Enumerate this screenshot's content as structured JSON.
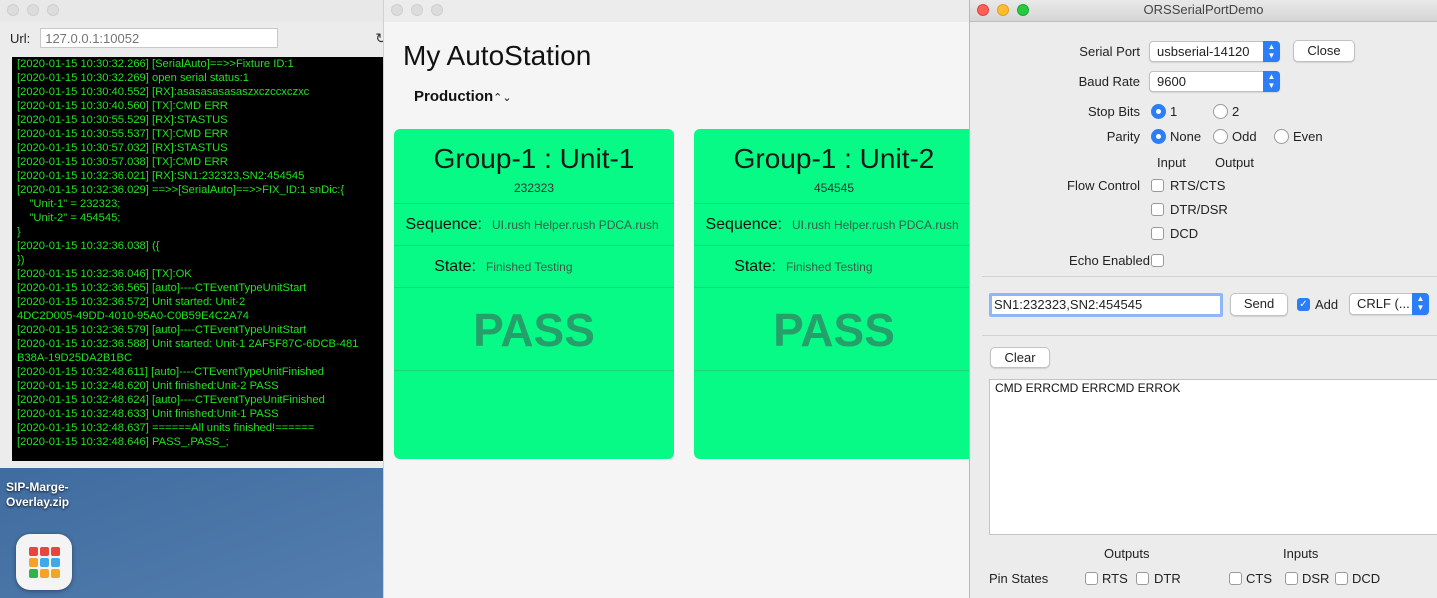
{
  "desktop": {
    "file_icon_label": "SIP-Marge-Overlay.zip",
    "launchpad_colors": [
      "#e8453c",
      "#e8453c",
      "#e8453c",
      "#f3a32a",
      "#3fa9e6",
      "#3fa9e6",
      "#34b24a",
      "#f3a32a",
      "#f3a32a"
    ]
  },
  "log_window": {
    "url_label": "Url:",
    "url_placeholder": "127.0.0.1:10052",
    "log_text": "[2020-01-15 10:30:32.266] [SerialAuto]==>>Fixture ID:1\n[2020-01-15 10:30:32.269] open serial status:1\n[2020-01-15 10:30:40.552] [RX]:asasasasasaszxczccxczxc\n[2020-01-15 10:30:40.560] [TX]:CMD ERR\n[2020-01-15 10:30:55.529] [RX]:STASTUS\n[2020-01-15 10:30:55.537] [TX]:CMD ERR\n[2020-01-15 10:30:57.032] [RX]:STASTUS\n[2020-01-15 10:30:57.038] [TX]:CMD ERR\n[2020-01-15 10:32:36.021] [RX]:SN1:232323,SN2:454545\n[2020-01-15 10:32:36.029] ==>>[SerialAuto]==>>FIX_ID:1 snDic:{\n    \"Unit-1\" = 232323;\n    \"Unit-2\" = 454545;\n}\n[2020-01-15 10:32:36.038] ({\n})\n[2020-01-15 10:32:36.046] [TX]:OK\n[2020-01-15 10:32:36.565] [auto]----CTEventTypeUnitStart\n[2020-01-15 10:32:36.572] Unit started: Unit-2\n4DC2D005-49DD-4010-95A0-C0B59E4C2A74\n[2020-01-15 10:32:36.579] [auto]----CTEventTypeUnitStart\n[2020-01-15 10:32:36.588] Unit started: Unit-1 2AF5F87C-6DCB-481\nB38A-19D25DA2B1BC\n[2020-01-15 10:32:48.611] [auto]----CTEventTypeUnitFinished\n[2020-01-15 10:32:48.620] Unit finished:Unit-2 PASS\n[2020-01-15 10:32:48.624] [auto]----CTEventTypeUnitFinished\n[2020-01-15 10:32:48.633] Unit finished:Unit-1 PASS\n[2020-01-15 10:32:48.637] ======All units finished!======\n[2020-01-15 10:32:48.646] PASS_,PASS_;"
  },
  "autostation": {
    "title": "My AutoStation",
    "mode": "Production",
    "units": [
      {
        "title": "Group-1 : Unit-1",
        "sn": "232323",
        "sequence_label": "Sequence:",
        "sequence": "UI.rush Helper.rush PDCA.rush",
        "state_label": "State:",
        "state": "Finished Testing",
        "result": "PASS"
      },
      {
        "title": "Group-1 : Unit-2",
        "sn": "454545",
        "sequence_label": "Sequence:",
        "sequence": "UI.rush Helper.rush PDCA.rush",
        "state_label": "State:",
        "state": "Finished Testing",
        "result": "PASS"
      }
    ],
    "card_color": "#07fa86"
  },
  "serial": {
    "window_title": "ORSSerialPortDemo",
    "serial_port_label": "Serial Port",
    "serial_port_value": "usbserial-14120",
    "close_button": "Close",
    "baud_rate_label": "Baud Rate",
    "baud_rate_value": "9600",
    "stop_bits_label": "Stop Bits",
    "stop_bits_1": "1",
    "stop_bits_2": "2",
    "parity_label": "Parity",
    "parity_none": "None",
    "parity_odd": "Odd",
    "parity_even": "Even",
    "input_header": "Input",
    "output_header": "Output",
    "flow_control_label": "Flow Control",
    "rts_cts": "RTS/CTS",
    "dtr_dsr": "DTR/DSR",
    "dcd": "DCD",
    "echo_label": "Echo Enabled",
    "send_value": "SN1:232323,SN2:454545",
    "send_button": "Send",
    "add_label": "Add",
    "line_ending": "CRLF (...",
    "clear_button": "Clear",
    "output_text": "CMD ERRCMD ERRCMD ERROK",
    "outputs_header": "Outputs",
    "inputs_header": "Inputs",
    "pin_states_label": "Pin States",
    "pin_rts": "RTS",
    "pin_dtr": "DTR",
    "pin_cts": "CTS",
    "pin_dsr": "DSR",
    "pin_dcd": "DCD",
    "accent_color": "#2b7ef8"
  }
}
